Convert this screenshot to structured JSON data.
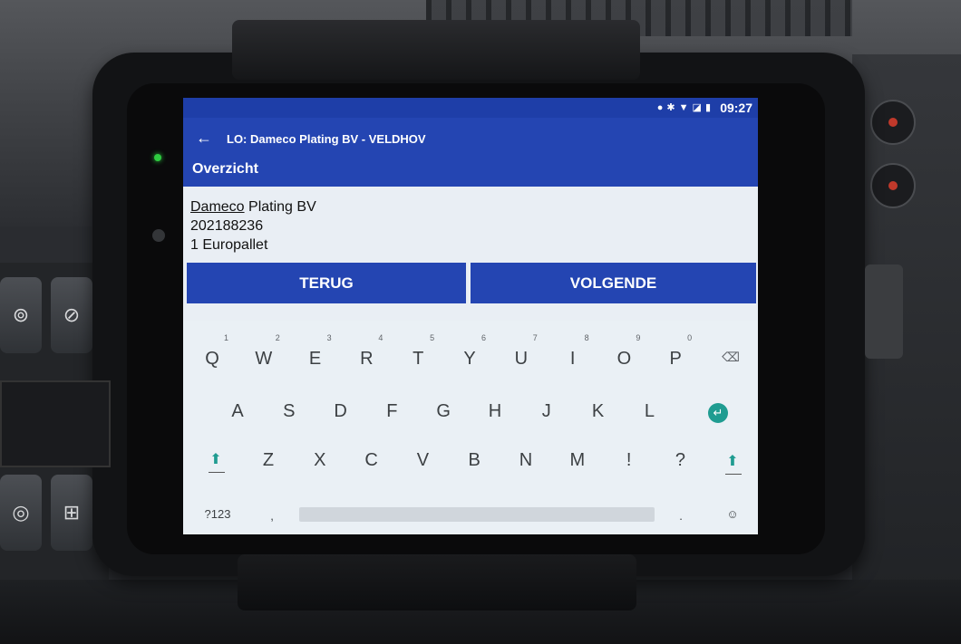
{
  "status_bar": {
    "icons": [
      "location-icon",
      "bluetooth-icon",
      "wifi-icon",
      "no-sim-icon",
      "battery-icon"
    ],
    "time": "09:27"
  },
  "app_bar": {
    "title": "LO: Dameco Plating BV - VELDHOV",
    "section": "Overzicht"
  },
  "info": {
    "company_underlined": "Dameco",
    "company_rest": " Plating BV",
    "number": "202188236",
    "load": "1 Europallet"
  },
  "buttons": {
    "back": "TERUG",
    "next": "VOLGENDE"
  },
  "keyboard": {
    "row1": [
      "Q",
      "W",
      "E",
      "R",
      "T",
      "Y",
      "U",
      "I",
      "O",
      "P"
    ],
    "row1_hints": [
      "1",
      "2",
      "3",
      "4",
      "5",
      "6",
      "7",
      "8",
      "9",
      "0"
    ],
    "row2": [
      "A",
      "S",
      "D",
      "F",
      "G",
      "H",
      "J",
      "K",
      "L"
    ],
    "row3": [
      "Z",
      "X",
      "C",
      "V",
      "B",
      "N",
      "M",
      "!",
      "?"
    ],
    "symbols": "?123",
    "comma": ",",
    "period": ".",
    "backspace_glyph": "⌫",
    "enter_glyph": "↵",
    "shift_glyph": "⬆",
    "emoji_glyph": "☺"
  },
  "colors": {
    "app_blue": "#2445b2",
    "accent_teal": "#1f9c91"
  }
}
